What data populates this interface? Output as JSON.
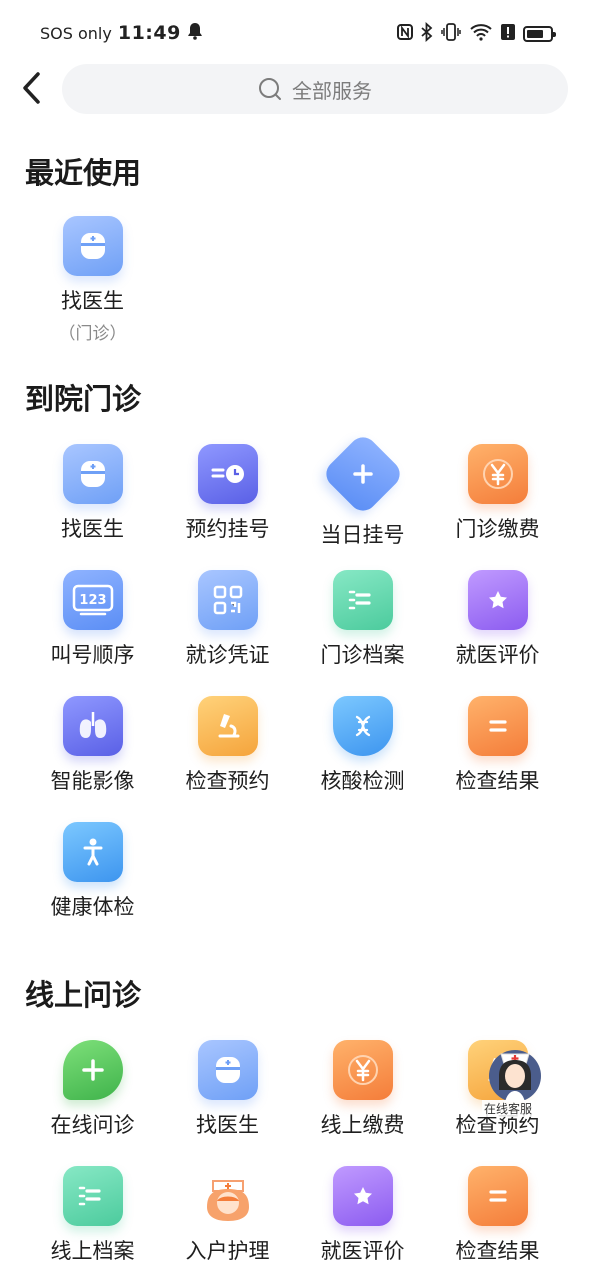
{
  "status_bar": {
    "carrier": "SOS only",
    "time": "11:49"
  },
  "search": {
    "placeholder": "全部服务"
  },
  "sections": {
    "recent": {
      "title": "最近使用",
      "items": [
        {
          "label": "找医生",
          "sub": "（门诊）",
          "icon": "doctor-icon"
        }
      ]
    },
    "outpatient": {
      "title": "到院门诊",
      "items": [
        {
          "label": "找医生",
          "icon": "doctor-icon"
        },
        {
          "label": "预约挂号",
          "icon": "appointment-clock-icon"
        },
        {
          "label": "当日挂号",
          "icon": "plus-diamond-icon"
        },
        {
          "label": "门诊缴费",
          "icon": "yen-coin-icon"
        },
        {
          "label": "叫号顺序",
          "icon": "queue-number-icon"
        },
        {
          "label": "就诊凭证",
          "icon": "qr-code-icon"
        },
        {
          "label": "门诊档案",
          "icon": "record-book-icon"
        },
        {
          "label": "就医评价",
          "icon": "star-bookmark-icon"
        },
        {
          "label": "智能影像",
          "icon": "lungs-icon"
        },
        {
          "label": "检查预约",
          "icon": "microscope-icon"
        },
        {
          "label": "核酸检测",
          "icon": "dna-shield-icon"
        },
        {
          "label": "检查结果",
          "icon": "report-icon"
        },
        {
          "label": "健康体检",
          "icon": "body-check-icon"
        }
      ]
    },
    "online": {
      "title": "线上问诊",
      "items": [
        {
          "label": "在线问诊",
          "icon": "chat-plus-icon"
        },
        {
          "label": "找医生",
          "icon": "doctor-icon"
        },
        {
          "label": "线上缴费",
          "icon": "yen-coin-icon"
        },
        {
          "label": "检查预约",
          "icon": "microscope-icon"
        },
        {
          "label": "线上档案",
          "icon": "record-book-icon"
        },
        {
          "label": "入户护理",
          "icon": "nurse-icon"
        },
        {
          "label": "就医评价",
          "icon": "star-bookmark-icon"
        },
        {
          "label": "检查结果",
          "icon": "report-icon"
        }
      ]
    }
  },
  "floating_service": {
    "label": "在线客服",
    "icon": "nurse-avatar-icon"
  }
}
